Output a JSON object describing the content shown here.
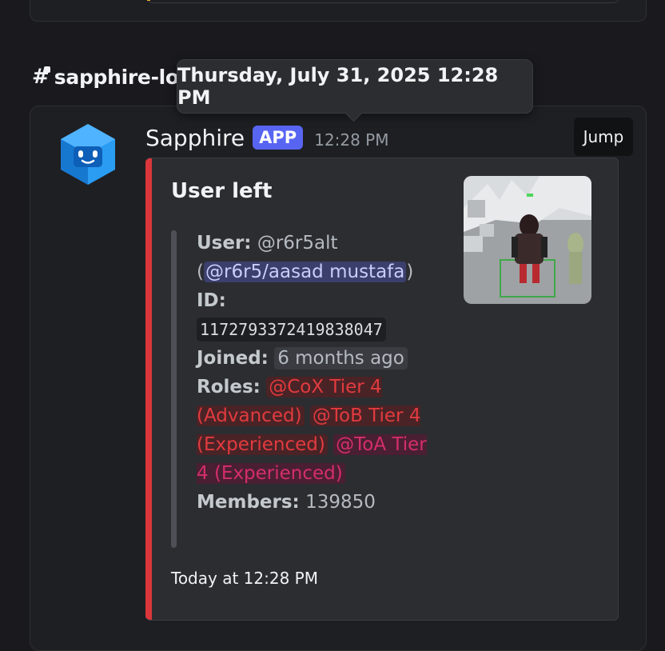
{
  "channel": {
    "name": "sapphire-lo",
    "icon": "hash-lock-icon"
  },
  "tooltip": {
    "text": "Thursday, July 31, 2025 12:28 PM"
  },
  "message": {
    "author": "Sapphire",
    "badge": "APP",
    "time": "12:28 PM",
    "jump_label": "Jump",
    "avatar": "sapphire-bot-avatar"
  },
  "embed": {
    "accent_color": "#da373c",
    "title": "User left",
    "user_label": "User:",
    "user_value": "@r6r5alt",
    "open_paren": "(",
    "mention": "@r6r5/aasad mustafa",
    "close_paren": ")",
    "id_label": "ID:",
    "id_value": "1172793372419838047",
    "joined_label": "Joined:",
    "joined_value": "6 months ago",
    "roles_label": "Roles:",
    "roles": [
      {
        "name": "@CoX Tier 4 (Advanced)",
        "color": "#e13b3f"
      },
      {
        "name": "@ToB Tier 4 (Experienced)",
        "color": "#e13b3f"
      },
      {
        "name": "@ToA Tier 4 (Experienced)",
        "color": "#d42e6a"
      }
    ],
    "members_label": "Members:",
    "members_value": "139850",
    "footer": "Today at 12:28 PM",
    "thumbnail": "game-character-thumbnail"
  }
}
